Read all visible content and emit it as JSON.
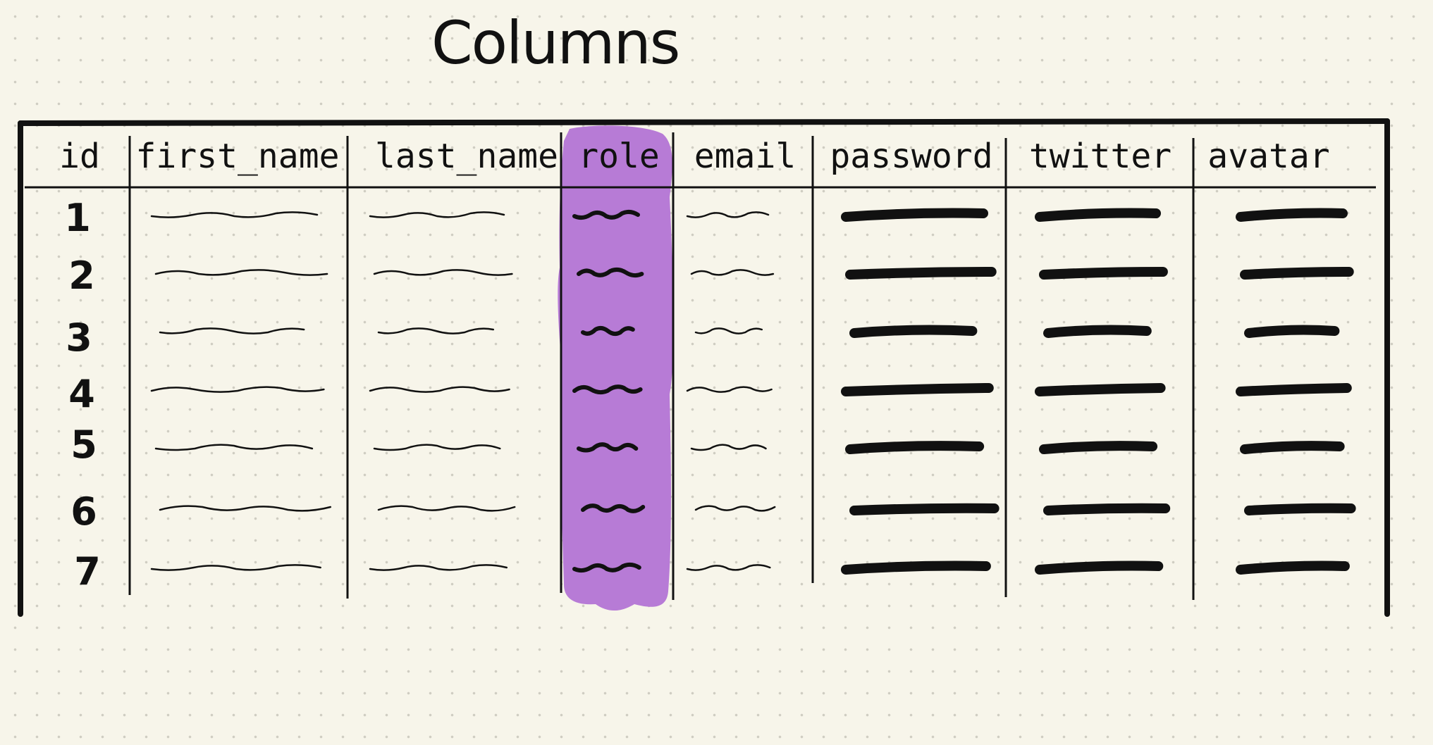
{
  "title": "Columns",
  "columns": [
    "id",
    "first_name",
    "last_name",
    "role",
    "email",
    "password",
    "twitter",
    "avatar"
  ],
  "highlighted_column": "role",
  "row_ids": [
    "1",
    "2",
    "3",
    "4",
    "5",
    "6",
    "7"
  ],
  "cell_style": {
    "first_name": "thin-scribble",
    "last_name": "thin-scribble",
    "role": "thick-scribble",
    "email": "thin-scribble",
    "password": "heavy-bar",
    "twitter": "heavy-bar",
    "avatar": "heavy-bar"
  },
  "colors": {
    "background": "#f7f5ea",
    "ink": "#111111",
    "highlight": "#b77bd6"
  }
}
